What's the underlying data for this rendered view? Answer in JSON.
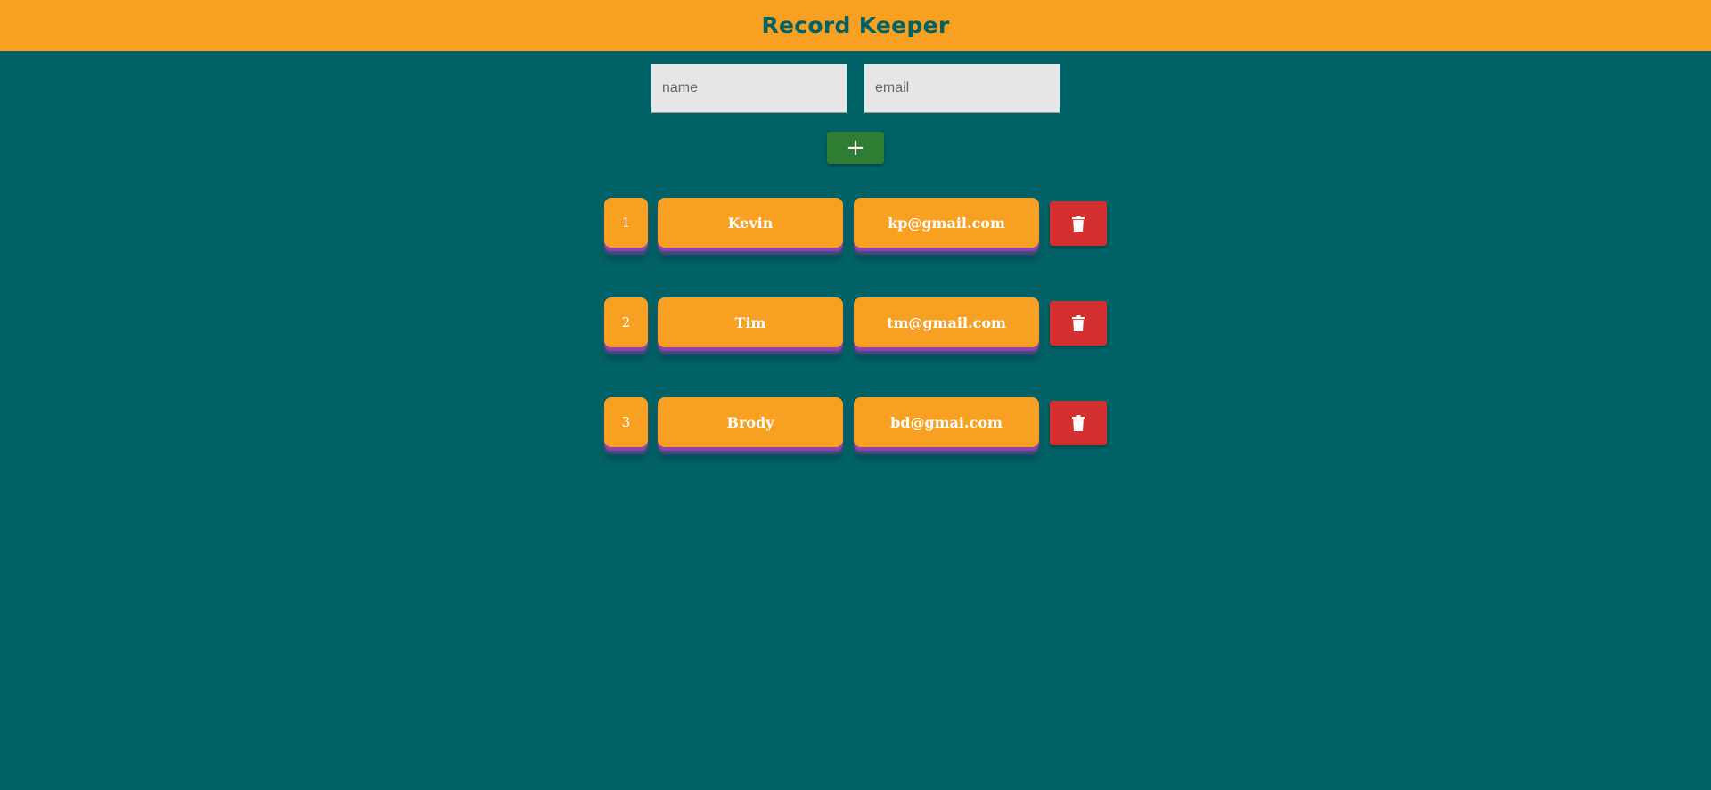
{
  "header": {
    "title": "Record Keeper"
  },
  "form": {
    "name_placeholder": "name",
    "email_placeholder": "email",
    "add_label": "+"
  },
  "records": [
    {
      "id": "1",
      "name": "Kevin",
      "email": "kp@gmail.com"
    },
    {
      "id": "2",
      "name": "Tim",
      "email": "tm@gmail.com"
    },
    {
      "id": "3",
      "name": "Brody",
      "email": "bd@gmai.com"
    }
  ],
  "icons": {
    "delete": "trash-icon",
    "add": "plus-icon"
  },
  "colors": {
    "background": "#006266",
    "header": "#f7a021",
    "title": "#006266",
    "cell": "#f7a021",
    "cell_shadow": "#8e44ad",
    "add_button": "#2e7d32",
    "delete_button": "#d32f2f"
  }
}
